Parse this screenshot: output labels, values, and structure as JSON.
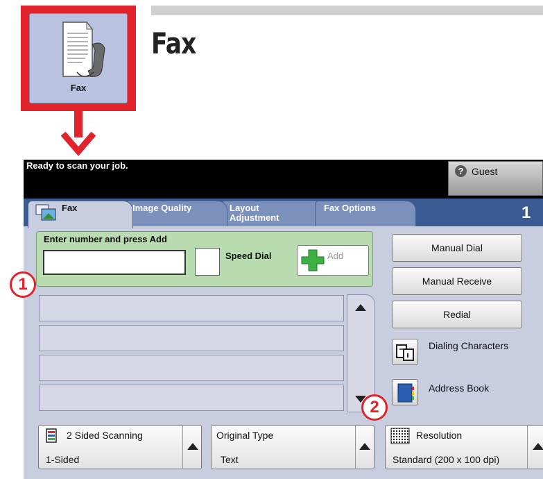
{
  "heading": {
    "icon_label": "Fax",
    "title": "Fax"
  },
  "status_bar": {
    "message": "Ready to scan your job.",
    "user_label": "Guest",
    "user_icon": "question-mark-icon"
  },
  "tabs": [
    {
      "label": "Fax",
      "active": true
    },
    {
      "label": "Image Quality",
      "active": false
    },
    {
      "label": "Layout Adjustment",
      "active": false
    },
    {
      "label": "Fax Options",
      "active": false
    }
  ],
  "page_number": "1",
  "entry": {
    "label": "Enter number and press Add",
    "number_value": "",
    "speed_dial_label": "Speed Dial",
    "add_label": "Add"
  },
  "recipient_rows": 4,
  "right_panel": {
    "manual_dial": "Manual Dial",
    "manual_receive": "Manual Receive",
    "redial": "Redial",
    "dialing_characters": "Dialing Characters",
    "address_book": "Address Book"
  },
  "features": [
    {
      "title": "2 Sided Scanning",
      "value": "1-Sided"
    },
    {
      "title": "Original Type",
      "value": "Text"
    },
    {
      "title": "Resolution",
      "value": "Standard (200 x 100 dpi)"
    }
  ],
  "callouts": [
    "1",
    "2"
  ],
  "colors": {
    "highlight_red": "#e1232b",
    "tab_band": "#3a5a92",
    "entry_green": "#b8dcb0",
    "add_plus_green": "#3cb043"
  }
}
